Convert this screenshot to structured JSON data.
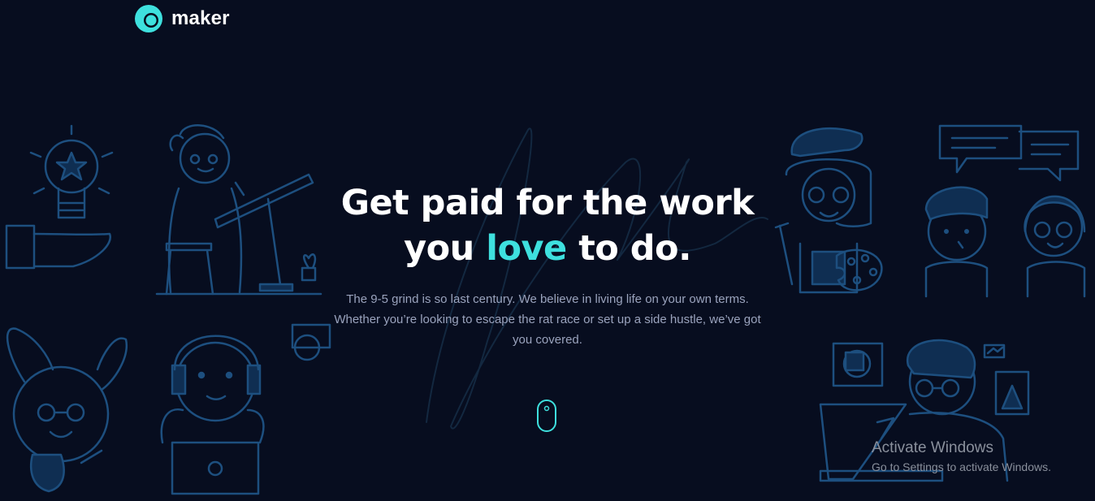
{
  "brand": {
    "name": "maker",
    "accent": "#3ee0de"
  },
  "hero": {
    "headline_line1": "Get paid for the work",
    "headline_you": "you",
    "headline_accent": "love",
    "headline_end": "to do.",
    "subtext": "The 9-5 grind is so last century. We believe in living life on your own terms. Whether you’re looking to escape the rat race or set up a side hustle, we’ve got you covered."
  },
  "scroll": {
    "icon": "mouse-scroll-icon"
  },
  "watermark": {
    "title": "Activate Windows",
    "subtitle": "Go to Settings to activate Windows."
  },
  "colors": {
    "background": "#070d1f",
    "illustration_stroke": "#1d4f7f",
    "illustration_fill": "#0f2e52",
    "text_muted": "#9aa3bd"
  }
}
